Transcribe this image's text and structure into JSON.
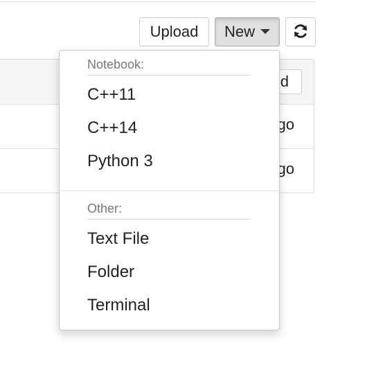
{
  "toolbar": {
    "upload_label": "Upload",
    "new_label": "New",
    "refresh_icon": "refresh-icon"
  },
  "file_list": {
    "sort_button_label": "ed",
    "rows": [
      {
        "modified": "go"
      },
      {
        "modified": "go"
      }
    ]
  },
  "new_menu": {
    "notebook_header": "Notebook:",
    "notebook_items": [
      "C++11",
      "C++14",
      "Python 3"
    ],
    "other_header": "Other:",
    "other_items": [
      "Text File",
      "Folder",
      "Terminal"
    ]
  }
}
